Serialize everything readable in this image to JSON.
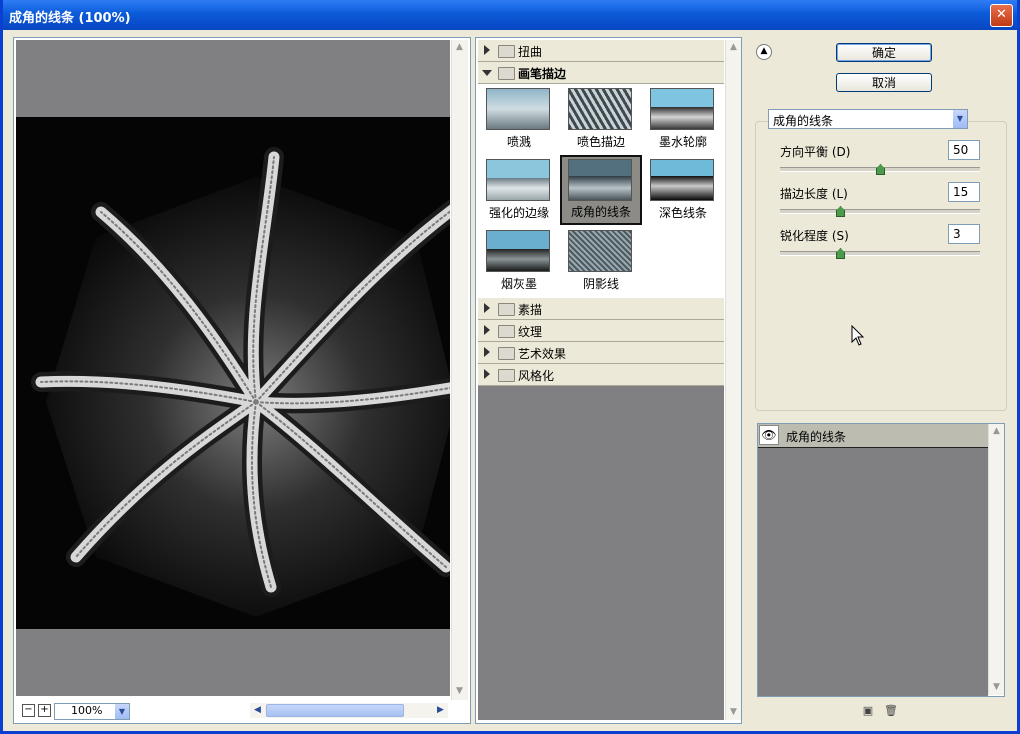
{
  "window": {
    "title": "成角的线条 (100%)",
    "close_glyph": "✕"
  },
  "preview": {
    "zoom_out": "−",
    "zoom_in": "+",
    "zoom_value": "100%"
  },
  "filter_gallery": {
    "categories_top": [
      {
        "label": "扭曲",
        "expanded": false
      },
      {
        "label": "画笔描边",
        "expanded": true
      }
    ],
    "thumbnails": [
      {
        "label": "喷溅",
        "selected": false
      },
      {
        "label": "喷色描边",
        "selected": false
      },
      {
        "label": "墨水轮廓",
        "selected": false
      },
      {
        "label": "强化的边缘",
        "selected": false
      },
      {
        "label": "成角的线条",
        "selected": true
      },
      {
        "label": "深色线条",
        "selected": false
      },
      {
        "label": "烟灰墨",
        "selected": false
      },
      {
        "label": "阴影线",
        "selected": false
      }
    ],
    "categories_bottom": [
      {
        "label": "素描"
      },
      {
        "label": "纹理"
      },
      {
        "label": "艺术效果"
      },
      {
        "label": "风格化"
      }
    ]
  },
  "options": {
    "ok_label": "确定",
    "cancel_label": "取消",
    "filter_select": "成角的线条",
    "sliders": [
      {
        "label": "方向平衡 (D)",
        "value": "50",
        "fraction": 0.5
      },
      {
        "label": "描边长度 (L)",
        "value": "15",
        "fraction": 0.3
      },
      {
        "label": "锐化程度 (S)",
        "value": "3",
        "fraction": 0.3
      }
    ]
  },
  "layers": {
    "items": [
      {
        "label": "成角的线条",
        "visible": true
      }
    ],
    "eye_glyph": "👁"
  }
}
